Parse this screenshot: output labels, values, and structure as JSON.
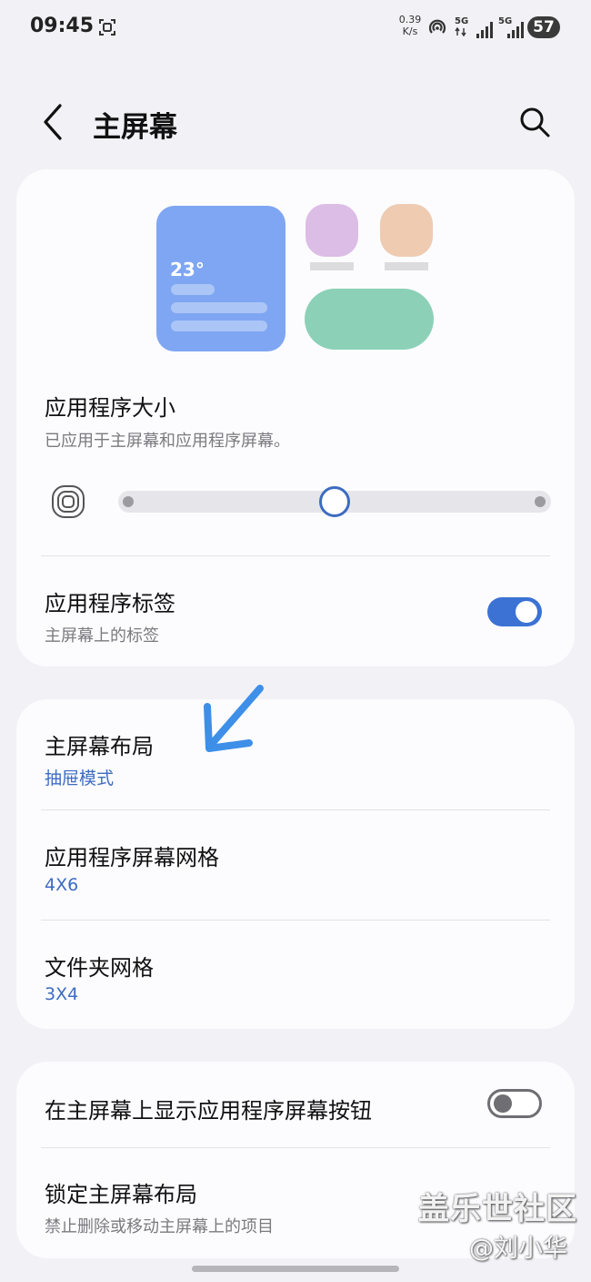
{
  "status_bar": {
    "time": "09:45",
    "net_speed_value": "0.39",
    "net_speed_unit": "K/s",
    "sim1_label": "5G",
    "sim2_label": "5G",
    "battery": "57"
  },
  "header": {
    "title": "主屏幕"
  },
  "preview": {
    "weather_temp": "23°"
  },
  "app_size": {
    "title": "应用程序大小",
    "subtitle": "已应用于主屏幕和应用程序屏幕。",
    "slider_position_fraction": 0.5
  },
  "app_labels": {
    "title": "应用程序标签",
    "subtitle": "主屏幕上的标签",
    "enabled": true
  },
  "home_layout": {
    "title": "主屏幕布局",
    "value": "抽屉模式"
  },
  "app_grid": {
    "title": "应用程序屏幕网格",
    "value": "4X6"
  },
  "folder_grid": {
    "title": "文件夹网格",
    "value": "3X4"
  },
  "show_apps_button": {
    "title": "在主屏幕上显示应用程序屏幕按钮",
    "enabled": false
  },
  "lock_layout": {
    "title": "锁定主屏幕布局",
    "subtitle": "禁止删除或移动主屏幕上的项目"
  },
  "watermark": {
    "brand": "盖乐世社区",
    "author": "@刘小华"
  },
  "colors": {
    "accent": "#3b72d4",
    "value_text": "#3d6cc1",
    "annotation_arrow": "#3d8fe8"
  }
}
